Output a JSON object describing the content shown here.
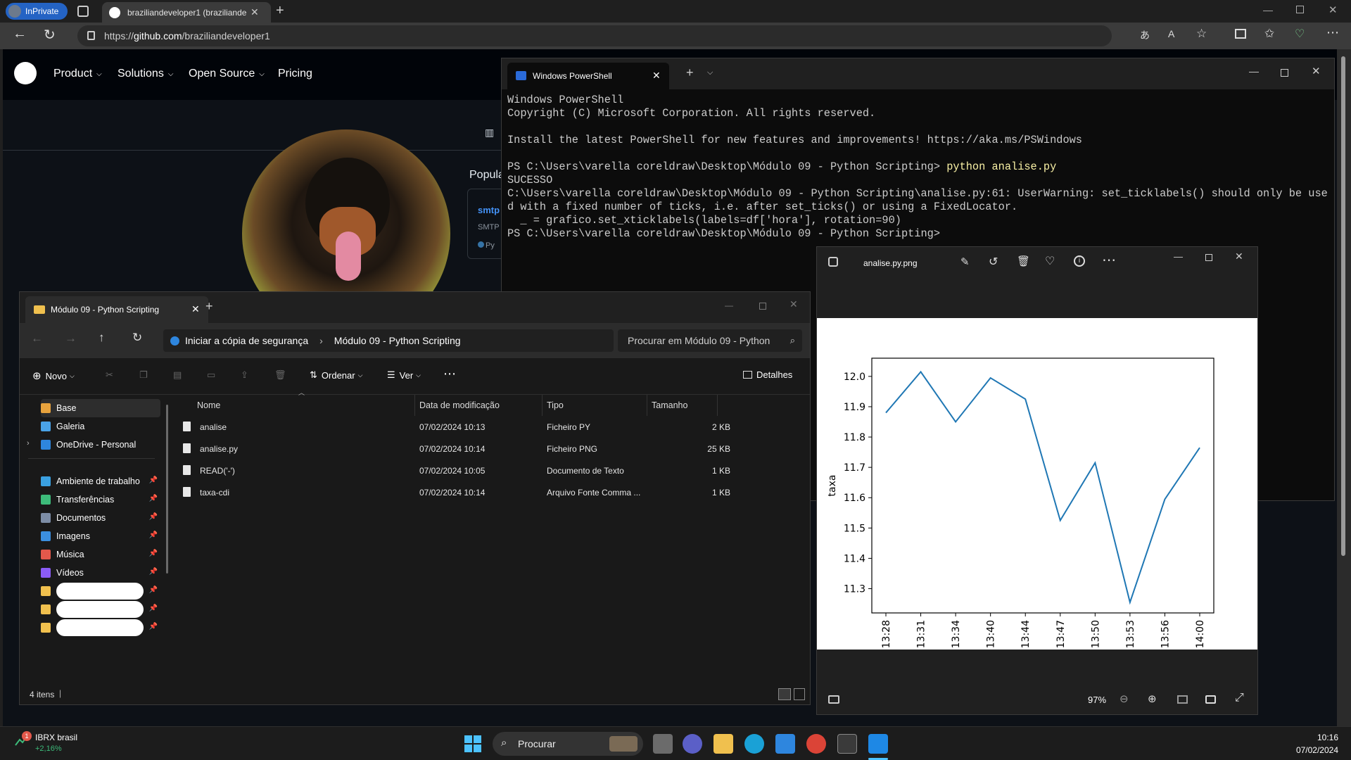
{
  "browser": {
    "inprivate": "InPrivate",
    "tab_title": "braziliandeveloper1 (braziliande",
    "url_scheme": "https://",
    "url_host": "github.com",
    "url_path": "/braziliandeveloper1"
  },
  "github": {
    "nav": [
      "Product",
      "Solutions",
      "Open Source",
      "Pricing"
    ],
    "popular_label": "Popula",
    "repo_snip": "smtp",
    "repo_desc_snip": "SMTP",
    "repo_lang_snip": "Py"
  },
  "powershell": {
    "tab_title": "Windows PowerShell",
    "lines": [
      {
        "text": "Windows PowerShell",
        "cmd": ""
      },
      {
        "text": "Copyright (C) Microsoft Corporation. All rights reserved.",
        "cmd": ""
      },
      {
        "text": " ",
        "cmd": ""
      },
      {
        "text": "Install the latest PowerShell for new features and improvements! https://aka.ms/PSWindows",
        "cmd": ""
      },
      {
        "text": " ",
        "cmd": ""
      },
      {
        "text": "PS C:\\Users\\varella coreldraw\\Desktop\\Módulo 09 - Python Scripting> ",
        "cmd": "python analise.py"
      },
      {
        "text": "SUCESSO",
        "cmd": ""
      },
      {
        "text": "C:\\Users\\varella coreldraw\\Desktop\\Módulo 09 - Python Scripting\\analise.py:61: UserWarning: set_ticklabels() should only be use",
        "cmd": ""
      },
      {
        "text": "d with a fixed number of ticks, i.e. after set_ticks() or using a FixedLocator.",
        "cmd": ""
      },
      {
        "text": "  _ = grafico.set_xticklabels(labels=df['hora'], rotation=90)",
        "cmd": ""
      },
      {
        "text": "PS C:\\Users\\varella coreldraw\\Desktop\\Módulo 09 - Python Scripting>",
        "cmd": ""
      }
    ]
  },
  "photos": {
    "title": "analise.py.png",
    "zoom": "97%"
  },
  "chart_data": {
    "type": "line",
    "title": "",
    "xlabel": "",
    "ylabel": "taxa",
    "categories": [
      "13:28",
      "13:31",
      "13:34",
      "13:40",
      "13:44",
      "13:47",
      "13:50",
      "13:53",
      "13:56",
      "14:00"
    ],
    "series": [
      {
        "values": [
          11.88,
          12.015,
          11.85,
          11.995,
          11.925,
          11.525,
          11.715,
          11.255,
          11.595,
          11.765
        ],
        "color": "#1f77b4"
      }
    ],
    "yticks": [
      11.3,
      11.4,
      11.5,
      11.6,
      11.7,
      11.8,
      11.9,
      12.0
    ],
    "ylim": [
      11.22,
      12.06
    ],
    "grid": false
  },
  "explorer": {
    "tab_title": "Módulo 09 - Python Scripting",
    "crumb_root": "Iniciar a cópia de segurança",
    "crumb_current": "Módulo 09 - Python Scripting",
    "search_placeholder": "Procurar em Módulo 09 - Python",
    "toolbar": {
      "new": "Novo",
      "sort": "Ordenar",
      "view": "Ver",
      "details": "Detalhes"
    },
    "sidebar": [
      {
        "label": "Base",
        "color": "#e8a33d",
        "pinned": false
      },
      {
        "label": "Galeria",
        "color": "#4aa3e8",
        "pinned": false
      },
      {
        "label": "OneDrive - Personal",
        "color": "#2e86de",
        "pinned": false
      },
      {
        "label": "Ambiente de trabalho",
        "color": "#3aa0e0",
        "pinned": true
      },
      {
        "label": "Transferências",
        "color": "#3dbb7a",
        "pinned": true
      },
      {
        "label": "Documentos",
        "color": "#7d8da6",
        "pinned": true
      },
      {
        "label": "Imagens",
        "color": "#3b8fe0",
        "pinned": true
      },
      {
        "label": "Música",
        "color": "#e3584b",
        "pinned": true
      },
      {
        "label": "Vídeos",
        "color": "#8b5cf6",
        "pinned": true
      }
    ],
    "columns": [
      "Nome",
      "Data de modificação",
      "Tipo",
      "Tamanho"
    ],
    "files": [
      {
        "name": "analise",
        "date": "07/02/2024 10:13",
        "type": "Ficheiro PY",
        "size": "2 KB"
      },
      {
        "name": "analise.py",
        "date": "07/02/2024 10:14",
        "type": "Ficheiro PNG",
        "size": "25 KB"
      },
      {
        "name": "READ('-')",
        "date": "07/02/2024 10:05",
        "type": "Documento de Texto",
        "size": "1 KB"
      },
      {
        "name": "taxa-cdi",
        "date": "07/02/2024 10:14",
        "type": "Arquivo Fonte Comma ...",
        "size": "1 KB"
      }
    ],
    "status": "4 itens"
  },
  "taskbar": {
    "widget_title": "IBRX brasil",
    "widget_value": "+2,16%",
    "widget_badge": "1",
    "search": "Procurar",
    "time": "10:16",
    "date": "07/02/2024"
  },
  "colors": {
    "accent": "#2463c4",
    "chart_line": "#1f77b4",
    "ps_command": "#f9f1a5"
  }
}
